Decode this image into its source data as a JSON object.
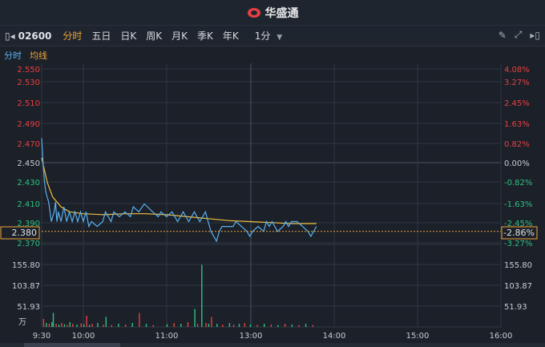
{
  "header": {
    "app_name": "华盛通"
  },
  "toolbar": {
    "stock_code": "02600",
    "tabs": [
      "分时",
      "五日",
      "日K",
      "周K",
      "月K",
      "季K",
      "年K"
    ],
    "active_tab": "分时",
    "interval": "1分"
  },
  "legend": {
    "intraday": "分时",
    "average": "均线"
  },
  "colors": {
    "up": "#e84040",
    "down": "#2ec27e",
    "price_line": "#5ab0f0",
    "avg_line": "#f0c040",
    "ref_line": "#f0a538",
    "bg": "#1b2029",
    "grid": "#2f3744"
  },
  "chart_data": {
    "type": "line",
    "price_ticks": [
      "2.550",
      "2.530",
      "2.510",
      "2.490",
      "2.470",
      "2.450",
      "2.430",
      "2.410",
      "2.390",
      "2.370"
    ],
    "pct_ticks": [
      "4.08%",
      "3.27%",
      "2.45%",
      "1.63%",
      "0.82%",
      "0.00%",
      "-0.82%",
      "-1.63%",
      "-2.45%",
      "-3.27%"
    ],
    "prev_close": 2.45,
    "current_price": "2.380",
    "current_pct": "-2.86%",
    "ylim": [
      2.36,
      2.555
    ],
    "volume_ticks": [
      "155.80",
      "103.87",
      "51.93"
    ],
    "volume_unit": "万",
    "volume_max": 155.8,
    "time_labels": [
      "9:30",
      "10:00",
      "11:00",
      "13:00",
      "14:00",
      "15:00",
      "16:00"
    ],
    "price_points": [
      [
        0,
        2.475
      ],
      [
        1,
        2.45
      ],
      [
        2,
        2.43
      ],
      [
        3,
        2.42
      ],
      [
        4,
        2.415
      ],
      [
        5,
        2.41
      ],
      [
        6,
        2.4
      ],
      [
        7,
        2.39
      ],
      [
        8,
        2.395
      ],
      [
        9,
        2.4
      ],
      [
        10,
        2.41
      ],
      [
        11,
        2.39
      ],
      [
        12,
        2.4
      ],
      [
        14,
        2.39
      ],
      [
        16,
        2.405
      ],
      [
        18,
        2.39
      ],
      [
        20,
        2.4
      ],
      [
        22,
        2.39
      ],
      [
        24,
        2.4
      ],
      [
        26,
        2.39
      ],
      [
        28,
        2.4
      ],
      [
        30,
        2.39
      ],
      [
        32,
        2.4
      ],
      [
        34,
        2.385
      ],
      [
        36,
        2.39
      ],
      [
        40,
        2.385
      ],
      [
        44,
        2.39
      ],
      [
        46,
        2.4
      ],
      [
        50,
        2.39
      ],
      [
        52,
        2.4
      ],
      [
        56,
        2.395
      ],
      [
        60,
        2.4
      ],
      [
        64,
        2.395
      ],
      [
        66,
        2.405
      ],
      [
        70,
        2.4
      ],
      [
        74,
        2.408
      ],
      [
        80,
        2.4
      ],
      [
        84,
        2.395
      ],
      [
        86,
        2.4
      ],
      [
        90,
        2.395
      ],
      [
        94,
        2.4
      ],
      [
        98,
        2.39
      ],
      [
        102,
        2.4
      ],
      [
        106,
        2.39
      ],
      [
        110,
        2.4
      ],
      [
        114,
        2.39
      ],
      [
        118,
        2.4
      ],
      [
        120,
        2.39
      ],
      [
        122,
        2.38
      ],
      [
        124,
        2.375
      ],
      [
        126,
        2.37
      ],
      [
        128,
        2.38
      ],
      [
        130,
        2.385
      ],
      [
        134,
        2.385
      ],
      [
        138,
        2.385
      ],
      [
        140,
        2.39
      ],
      [
        144,
        2.385
      ],
      [
        148,
        2.38
      ],
      [
        150,
        2.375
      ],
      [
        152,
        2.38
      ],
      [
        156,
        2.385
      ],
      [
        160,
        2.38
      ],
      [
        162,
        2.39
      ],
      [
        164,
        2.385
      ],
      [
        166,
        2.39
      ],
      [
        170,
        2.38
      ],
      [
        174,
        2.385
      ],
      [
        176,
        2.39
      ],
      [
        178,
        2.385
      ],
      [
        180,
        2.39
      ],
      [
        184,
        2.39
      ],
      [
        188,
        2.385
      ],
      [
        192,
        2.38
      ],
      [
        194,
        2.375
      ],
      [
        196,
        2.38
      ],
      [
        198,
        2.385
      ]
    ],
    "avg_points": [
      [
        0,
        2.455
      ],
      [
        4,
        2.43
      ],
      [
        8,
        2.415
      ],
      [
        14,
        2.405
      ],
      [
        20,
        2.4
      ],
      [
        30,
        2.398
      ],
      [
        45,
        2.397
      ],
      [
        60,
        2.398
      ],
      [
        75,
        2.398
      ],
      [
        90,
        2.397
      ],
      [
        105,
        2.395
      ],
      [
        120,
        2.393
      ],
      [
        135,
        2.391
      ],
      [
        150,
        2.39
      ],
      [
        165,
        2.389
      ],
      [
        180,
        2.388
      ],
      [
        198,
        2.388
      ]
    ],
    "volumes": [
      [
        1,
        20,
        "up"
      ],
      [
        3,
        10,
        "down"
      ],
      [
        5,
        8,
        "up"
      ],
      [
        7,
        12,
        "down"
      ],
      [
        8,
        35,
        "down"
      ],
      [
        10,
        8,
        "up"
      ],
      [
        12,
        6,
        "down"
      ],
      [
        14,
        10,
        "up"
      ],
      [
        16,
        7,
        "down"
      ],
      [
        18,
        5,
        "up"
      ],
      [
        20,
        12,
        "down"
      ],
      [
        22,
        8,
        "up"
      ],
      [
        25,
        6,
        "down"
      ],
      [
        28,
        9,
        "up"
      ],
      [
        30,
        7,
        "down"
      ],
      [
        32,
        28,
        "up"
      ],
      [
        34,
        5,
        "down"
      ],
      [
        36,
        8,
        "up"
      ],
      [
        40,
        10,
        "down"
      ],
      [
        44,
        6,
        "up"
      ],
      [
        46,
        25,
        "down"
      ],
      [
        50,
        5,
        "up"
      ],
      [
        55,
        8,
        "down"
      ],
      [
        60,
        6,
        "up"
      ],
      [
        65,
        10,
        "down"
      ],
      [
        70,
        35,
        "up"
      ],
      [
        75,
        8,
        "down"
      ],
      [
        80,
        5,
        "up"
      ],
      [
        90,
        7,
        "down"
      ],
      [
        95,
        10,
        "up"
      ],
      [
        100,
        8,
        "down"
      ],
      [
        105,
        12,
        "up"
      ],
      [
        110,
        45,
        "down"
      ],
      [
        112,
        8,
        "up"
      ],
      [
        115,
        155,
        "down"
      ],
      [
        118,
        10,
        "up"
      ],
      [
        120,
        8,
        "down"
      ],
      [
        122,
        25,
        "up"
      ],
      [
        126,
        8,
        "down"
      ],
      [
        130,
        6,
        "up"
      ],
      [
        135,
        10,
        "down"
      ],
      [
        138,
        6,
        "up"
      ],
      [
        142,
        8,
        "down"
      ],
      [
        146,
        10,
        "up"
      ],
      [
        150,
        6,
        "down"
      ],
      [
        155,
        5,
        "up"
      ],
      [
        160,
        8,
        "down"
      ],
      [
        165,
        6,
        "up"
      ],
      [
        170,
        5,
        "down"
      ],
      [
        175,
        8,
        "up"
      ],
      [
        180,
        6,
        "down"
      ],
      [
        185,
        5,
        "up"
      ],
      [
        190,
        8,
        "down"
      ],
      [
        195,
        5,
        "up"
      ]
    ]
  }
}
